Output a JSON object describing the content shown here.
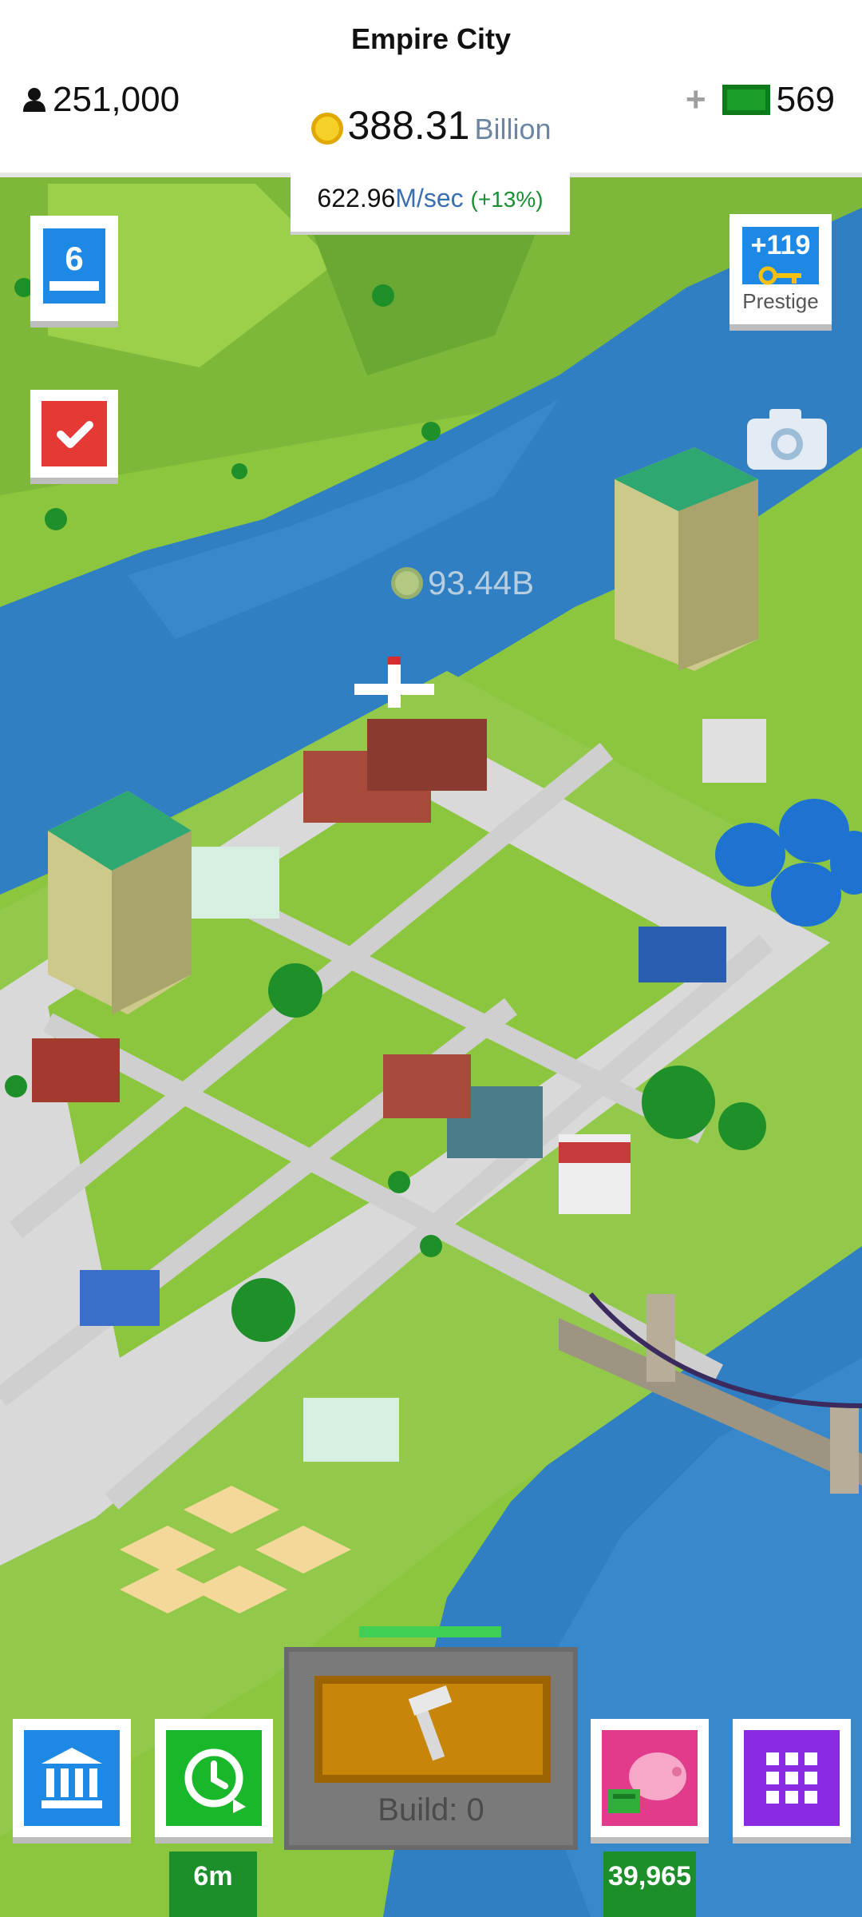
{
  "header": {
    "city_name": "Empire City",
    "population": "251,000",
    "money_amount": "388.31",
    "money_unit": "Billion",
    "gems_plus": "+",
    "gems": "569"
  },
  "income": {
    "amount": "622.96",
    "unit": "M/sec",
    "bonus": "(+13%)"
  },
  "left_buttons": {
    "level": "6"
  },
  "prestige": {
    "value": "+119",
    "label": "Prestige"
  },
  "floating_income": "93.44B",
  "bottom_bar": {
    "boost_time": "6m",
    "piggy_bank_amount": "39,965",
    "build_label": "Build: 0"
  },
  "icons": [
    "person-icon",
    "coin-icon",
    "cash-icon",
    "check-icon",
    "key-icon",
    "camera-icon",
    "bank-icon",
    "clock-refresh-icon",
    "piggy-bank-icon",
    "grid-icon",
    "hammer-icon",
    "airplane-icon"
  ],
  "colors": {
    "accent_blue": "#1e88e5",
    "accent_green": "#19b82a",
    "accent_red": "#e53935",
    "accent_pink": "#e23a8c",
    "accent_purple": "#8a2be2",
    "river": "#2f7fc2",
    "grass": "#8cc63f"
  }
}
